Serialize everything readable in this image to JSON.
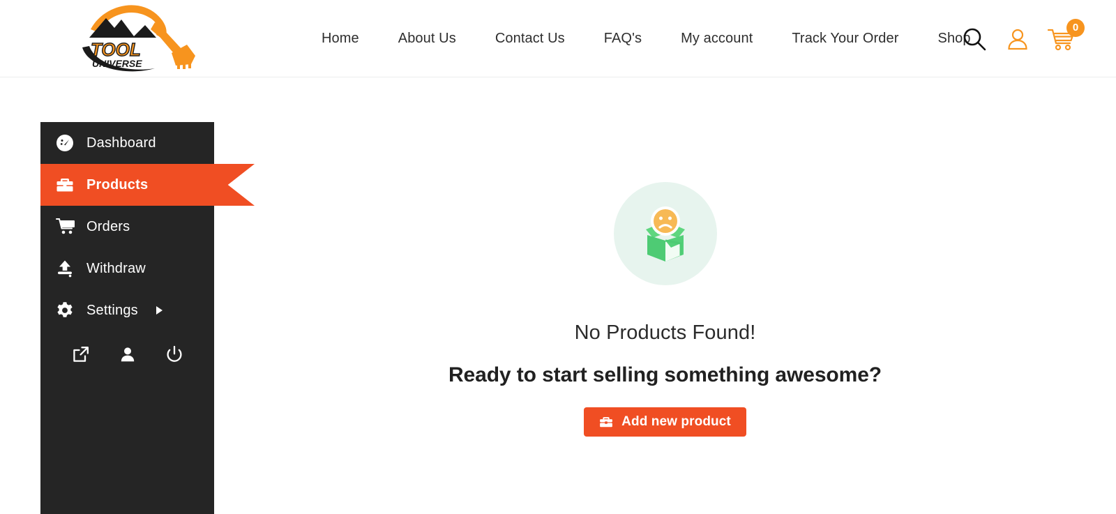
{
  "header": {
    "logo": {
      "icon": "tool-universe-logo",
      "line1": "TOOL",
      "line2": "UNIVERSE"
    },
    "nav": [
      {
        "label": "Home",
        "name": "nav-home"
      },
      {
        "label": "About Us",
        "name": "nav-about-us"
      },
      {
        "label": "Contact Us",
        "name": "nav-contact-us"
      },
      {
        "label": "FAQ's",
        "name": "nav-faqs"
      },
      {
        "label": "My account",
        "name": "nav-my-account"
      },
      {
        "label": "Track Your Order",
        "name": "nav-track-your-order"
      },
      {
        "label": "Shop",
        "name": "nav-shop"
      }
    ],
    "actions": {
      "search_icon": "search-icon",
      "account_icon": "user-account-icon",
      "cart_icon": "shopping-cart-icon",
      "cart_count": "0"
    }
  },
  "sidebar": {
    "items": [
      {
        "label": "Dashboard",
        "icon": "speedometer-icon",
        "active": false,
        "has_submenu": false
      },
      {
        "label": "Products",
        "icon": "briefcase-icon",
        "active": true,
        "has_submenu": false
      },
      {
        "label": "Orders",
        "icon": "shopping-cart-icon",
        "active": false,
        "has_submenu": false
      },
      {
        "label": "Withdraw",
        "icon": "upload-icon",
        "active": false,
        "has_submenu": false
      },
      {
        "label": "Settings",
        "icon": "gear-icon",
        "active": false,
        "has_submenu": true
      }
    ],
    "footer_icons": [
      {
        "name": "external-link-icon"
      },
      {
        "name": "user-icon"
      },
      {
        "name": "power-logout-icon"
      }
    ]
  },
  "main": {
    "illustration": "empty-box-sad-face-icon",
    "title": "No Products Found!",
    "subtitle": "Ready to start selling something awesome?",
    "add_button_label": "Add new product",
    "add_button_icon": "briefcase-icon"
  },
  "colors": {
    "accent_orange": "#F04E23",
    "brand_orange": "#F7941E",
    "sidebar_dark": "#252525",
    "illustration_bg": "#E7F4EE",
    "illustration_green": "#4FD07A",
    "illustration_face": "#F7B955"
  }
}
